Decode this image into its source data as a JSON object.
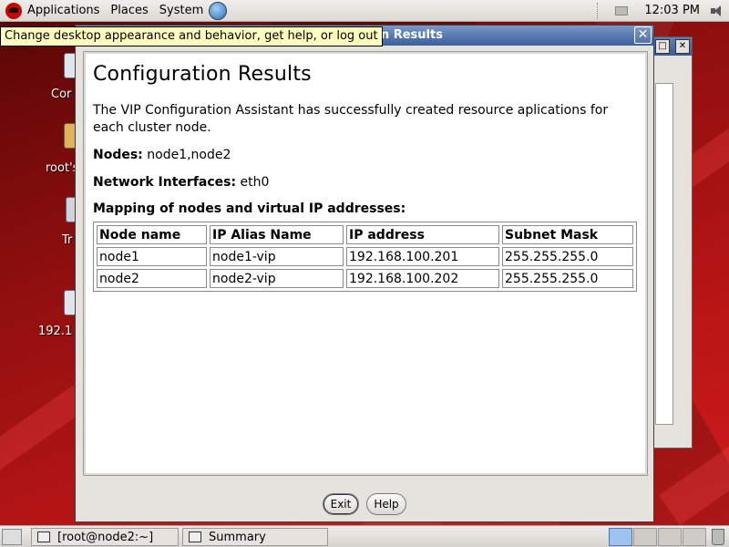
{
  "top_panel": {
    "applications": "Applications",
    "places": "Places",
    "system": "System",
    "clock": "12:03 PM"
  },
  "tooltip": "Change desktop appearance and behavior, get help, or log out",
  "desktop_icons": [
    {
      "label": "Cor"
    },
    {
      "label": "root's"
    },
    {
      "label": "Tr"
    },
    {
      "label": "192.1"
    }
  ],
  "dialog": {
    "title_visible": "on Results",
    "close": "✕",
    "heading": "Configuration Results",
    "intro": "The VIP Configuration Assistant has successfully created resource aplications for each cluster node.",
    "nodes_label": "Nodes:",
    "nodes_value": "node1,node2",
    "interfaces_label": "Network Interfaces:",
    "interfaces_value": "eth0",
    "mapping_title": "Mapping of nodes and virtual IP addresses:",
    "table": {
      "headers": [
        "Node name",
        "IP Alias Name",
        "IP address",
        "Subnet Mask"
      ],
      "rows": [
        [
          "node1",
          "node1-vip",
          "192.168.100.201",
          "255.255.255.0"
        ],
        [
          "node2",
          "node2-vip",
          "192.168.100.202",
          "255.255.255.0"
        ]
      ]
    },
    "exit_label": "Exit",
    "help_label": "Help"
  },
  "taskbar": {
    "tasks": [
      {
        "label": "[root@node2:~]"
      },
      {
        "label": "Summary"
      }
    ]
  },
  "colors": {
    "desktop": "#b81515",
    "titlebar": "#3b5f9c",
    "tooltip": "#ffffbf"
  }
}
